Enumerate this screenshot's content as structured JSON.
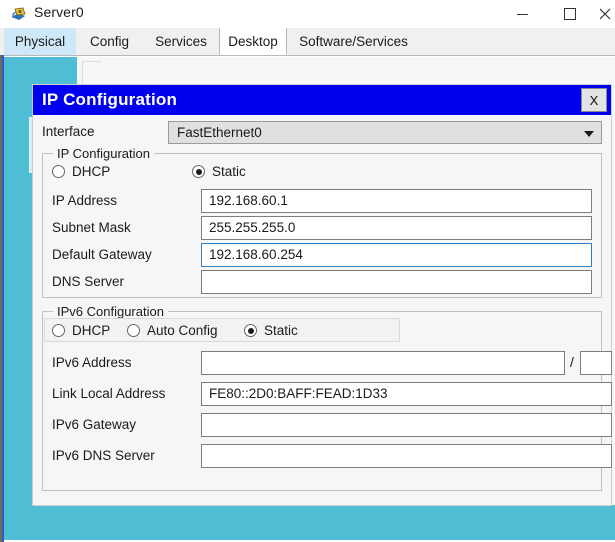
{
  "window": {
    "title": "Server0",
    "icon": "server-icon",
    "controls": {
      "minimize": "minimize-icon",
      "maximize": "maximize-icon",
      "close": "close-icon"
    }
  },
  "tabs": [
    {
      "label": "Physical",
      "state": "hover"
    },
    {
      "label": "Config",
      "state": "normal"
    },
    {
      "label": "Services",
      "state": "normal"
    },
    {
      "label": "Desktop",
      "state": "active"
    },
    {
      "label": "Software/Services",
      "state": "normal"
    }
  ],
  "desktop": {
    "background_color": "#4fbdd4",
    "tiles": [
      {
        "icon": "ip-configuration-icon"
      },
      {
        "icon": "dial-up-icon"
      },
      {
        "icon": "terminal-icon"
      },
      {
        "icon": "command-prompt-icon"
      },
      {
        "icon": "web-browser-icon"
      }
    ]
  },
  "dialog": {
    "title": "IP Configuration",
    "close_label": "X",
    "title_bg": "#0000ee",
    "interface": {
      "label": "Interface",
      "value": "FastEthernet0",
      "options": [
        "FastEthernet0"
      ]
    },
    "ipv4": {
      "group_label": "IP Configuration",
      "modes": [
        {
          "label": "DHCP",
          "selected": false
        },
        {
          "label": "Static",
          "selected": true
        }
      ],
      "fields": [
        {
          "label": "IP Address",
          "value": "192.168.60.1",
          "focused": false,
          "placeholder": ""
        },
        {
          "label": "Subnet Mask",
          "value": "255.255.255.0",
          "focused": false,
          "placeholder": ""
        },
        {
          "label": "Default Gateway",
          "value": "192.168.60.254",
          "focused": true,
          "placeholder": ""
        },
        {
          "label": "DNS Server",
          "value": "",
          "focused": false,
          "placeholder": ""
        }
      ]
    },
    "ipv6": {
      "group_label": "IPv6 Configuration",
      "modes": [
        {
          "label": "DHCP",
          "selected": false
        },
        {
          "label": "Auto Config",
          "selected": false
        },
        {
          "label": "Static",
          "selected": true
        }
      ],
      "prefix_separator": "/",
      "prefix_value": "",
      "fields": [
        {
          "label": "IPv6 Address",
          "value": "",
          "focused": false,
          "placeholder": ""
        },
        {
          "label": "Link Local Address",
          "value": "FE80::2D0:BAFF:FEAD:1D33",
          "focused": false,
          "placeholder": ""
        },
        {
          "label": "IPv6 Gateway",
          "value": "",
          "focused": false,
          "placeholder": ""
        },
        {
          "label": "IPv6 DNS Server",
          "value": "",
          "focused": false,
          "placeholder": ""
        }
      ]
    }
  }
}
